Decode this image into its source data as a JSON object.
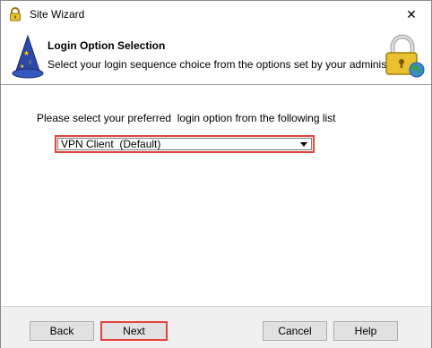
{
  "window": {
    "title": "Site Wizard",
    "close_glyph": "✕"
  },
  "header": {
    "title": "Login Option Selection",
    "subtitle": "Select your login sequence choice from the options set by your administrator"
  },
  "content": {
    "prompt": "Please select your preferred  login option from the following list",
    "login_option": {
      "selected": "VPN Client  (Default)"
    }
  },
  "footer": {
    "back_label": "Back",
    "next_label": "Next",
    "cancel_label": "Cancel",
    "help_label": "Help"
  },
  "icons": {
    "title": "padlock-icon",
    "wizard": "wizard-hat-icon",
    "lock": "lock-globe-icon",
    "close": "close-icon",
    "dropdown": "chevron-down-icon"
  },
  "colors": {
    "highlight": "#e0443c"
  }
}
